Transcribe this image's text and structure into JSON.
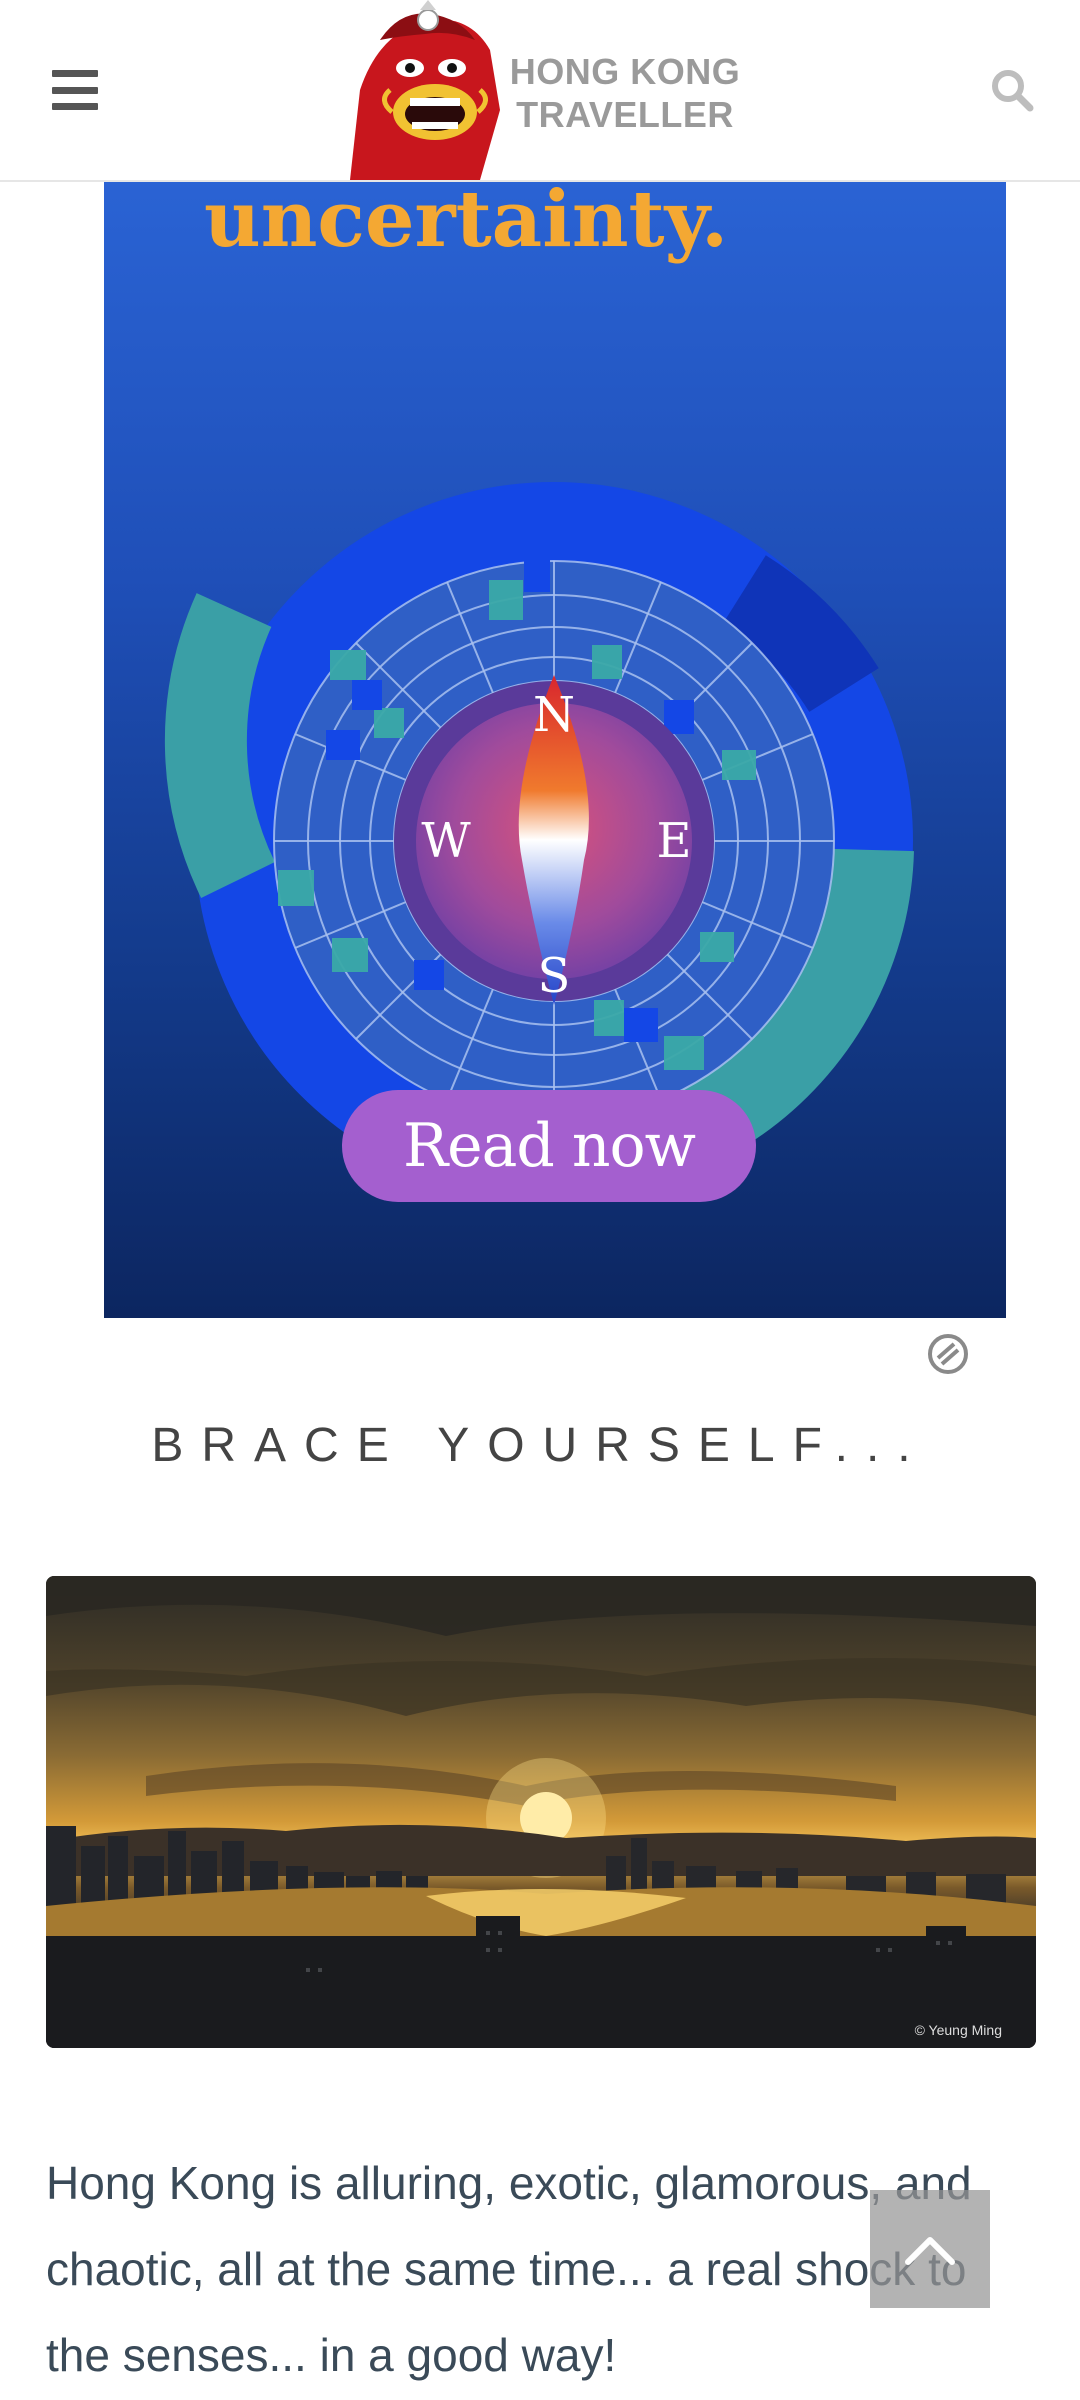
{
  "header": {
    "logo_line1": "HONG KONG",
    "logo_line2": "TRAVELLER",
    "menu_icon": "hamburger-menu-icon",
    "search_icon": "search-icon"
  },
  "ad": {
    "headline_word": "uncertainty.",
    "cta_label": "Read now",
    "compass_labels": {
      "north": "N",
      "south": "S",
      "east": "E",
      "west": "W"
    },
    "adchoices_icon": "adchoices-icon",
    "colors": {
      "headline": "#f4a833",
      "cta": "#a45fcf",
      "ring_blue": "#1447e6",
      "ring_teal": "#3a9fa6"
    }
  },
  "section": {
    "heading": "BRACE YOURSELF..."
  },
  "photo": {
    "credit": "© Yeung Ming",
    "alt": "Hong Kong harbour sunset"
  },
  "intro": {
    "text": "Hong Kong is alluring, exotic, glamorous, and chaotic, all at the same time... a real shock to the senses... in a good way!"
  },
  "back_to_top": {
    "icon": "chevron-up-icon"
  }
}
